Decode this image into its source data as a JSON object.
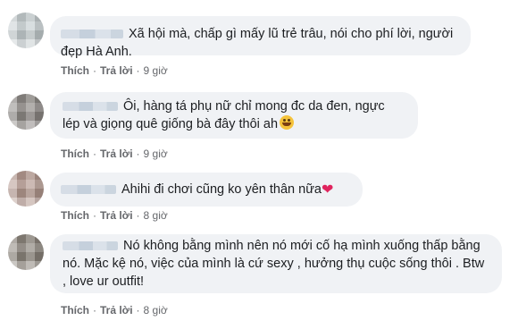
{
  "comments": [
    {
      "text": "Xã hội mà, chấp gì mấy lũ trẻ trâu, nói cho phí lời, người đẹp Hà Anh.",
      "like_label": "Thích",
      "reply_label": "Trả lời",
      "time": "9 giờ"
    },
    {
      "text": "Ôi, hàng tá phụ nữ chỉ mong đc da đen, ngực lép và giọng quê giống bà đây thôi ah",
      "emoji": "grinning-face-emoji",
      "like_label": "Thích",
      "reply_label": "Trả lời",
      "time": "9 giờ"
    },
    {
      "text": "Ahihi đi chơi cũng ko yên thân nữa",
      "emoji": "red-heart-emoji",
      "heart": "❤",
      "like_label": "Thích",
      "reply_label": "Trả lời",
      "time": "8 giờ"
    },
    {
      "text": "Nó không bằng mình nên nó mới cố hạ mình xuống thấp bằng nó. Mặc kệ nó, việc của mình là cứ sexy , hưởng thụ cuộc sống thôi . Btw , love ur outfit!",
      "like_label": "Thích",
      "reply_label": "Trả lời",
      "time": "8 giờ"
    }
  ],
  "separator": "·",
  "colors": {
    "bubble": "#f0f2f5",
    "meta": "#65676b",
    "text": "#1c1e21",
    "heart": "#e0245e"
  }
}
